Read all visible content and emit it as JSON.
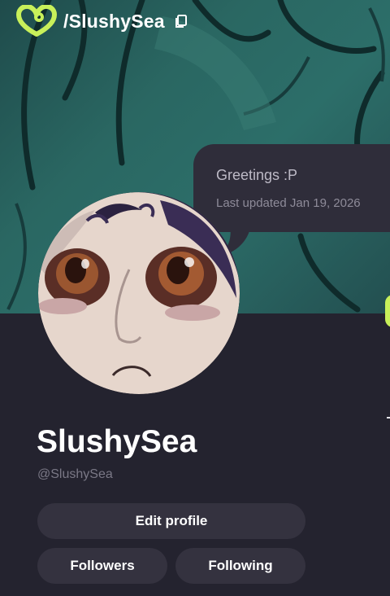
{
  "header": {
    "logo_icon": "heart-swirl-logo-icon",
    "handle_path": "/SlushySea",
    "copy_icon": "copy-icon",
    "accent_color": "#c8f05a"
  },
  "status": {
    "text": "Greetings :P",
    "updated": "Last updated Jan 19, 2026"
  },
  "profile": {
    "display_name": "SlushySea",
    "username": "@SlushySea"
  },
  "actions": {
    "edit_profile": "Edit profile",
    "followers": "Followers",
    "following": "Following"
  }
}
